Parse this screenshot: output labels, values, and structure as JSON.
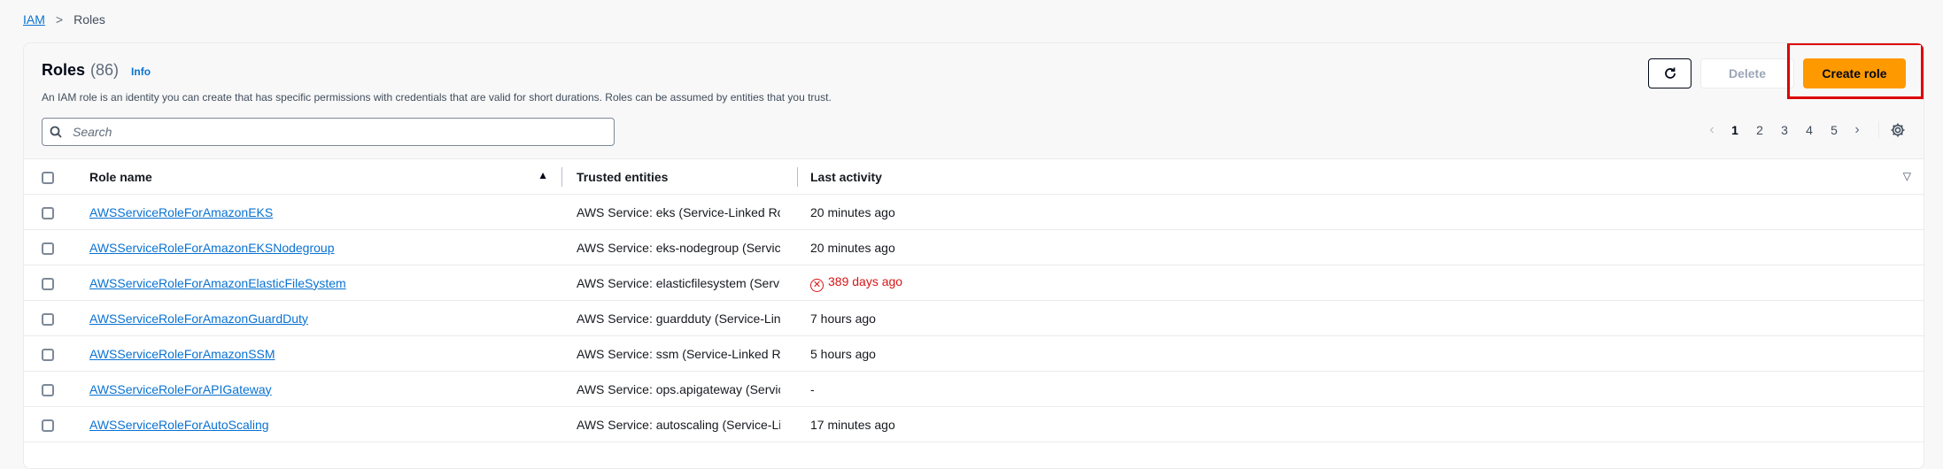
{
  "breadcrumb": {
    "root": "IAM",
    "separator": ">",
    "current": "Roles"
  },
  "panel": {
    "title": "Roles",
    "count": "(86)",
    "info": "Info",
    "description": "An IAM role is an identity you can create that has specific permissions with credentials that are valid for short durations. Roles can be assumed by entities that you trust."
  },
  "actions": {
    "refresh_icon": "refresh-icon",
    "delete_label": "Delete",
    "create_label": "Create role"
  },
  "search": {
    "placeholder": "Search"
  },
  "pagination": {
    "pages": [
      "1",
      "2",
      "3",
      "4",
      "5"
    ],
    "current": "1"
  },
  "table": {
    "headers": {
      "name": "Role name",
      "trusted": "Trusted entities",
      "activity": "Last activity"
    },
    "rows": [
      {
        "name": "AWSServiceRoleForAmazonEKS",
        "trusted_prefix": "AWS Service: eks",
        "trusted_link": "Service-Linked Role",
        "activity": "20 minutes ago",
        "warning": false
      },
      {
        "name": "AWSServiceRoleForAmazonEKSNodegroup",
        "trusted_prefix": "AWS Service: eks-nodegroup",
        "trusted_link": "Service-Linked Role",
        "activity": "20 minutes ago",
        "warning": false
      },
      {
        "name": "AWSServiceRoleForAmazonElasticFileSystem",
        "trusted_prefix": "AWS Service: elasticfilesystem",
        "trusted_link": "Service-Linked Role",
        "activity": "389 days ago",
        "warning": true
      },
      {
        "name": "AWSServiceRoleForAmazonGuardDuty",
        "trusted_prefix": "AWS Service: guardduty",
        "trusted_link": "Service-Linked Role",
        "activity": "7 hours ago",
        "warning": false
      },
      {
        "name": "AWSServiceRoleForAmazonSSM",
        "trusted_prefix": "AWS Service: ssm",
        "trusted_link": "Service-Linked Role",
        "activity": "5 hours ago",
        "warning": false
      },
      {
        "name": "AWSServiceRoleForAPIGateway",
        "trusted_prefix": "AWS Service: ops.apigateway",
        "trusted_link": "Service-Linked Role",
        "activity": "-",
        "warning": false
      },
      {
        "name": "AWSServiceRoleForAutoScaling",
        "trusted_prefix": "AWS Service: autoscaling",
        "trusted_link": "Service-Linked Role",
        "activity": "17 minutes ago",
        "warning": false
      }
    ]
  },
  "colors": {
    "accent": "#ff9900",
    "link": "#0972d3",
    "error": "#d91515",
    "highlight": "#dd0000"
  }
}
